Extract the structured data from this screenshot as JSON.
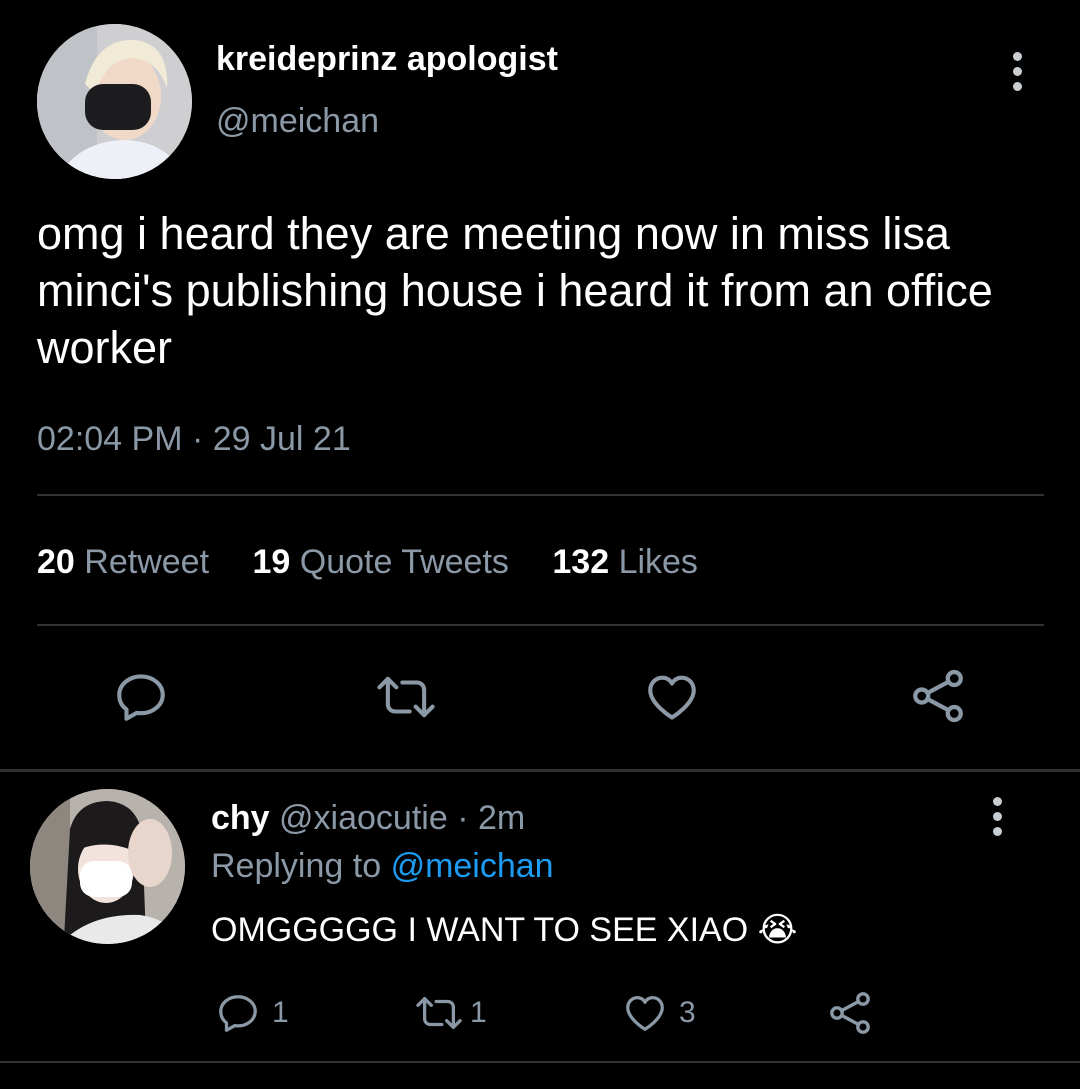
{
  "tweet": {
    "author_name": "kreideprinz apologist",
    "author_handle": "@meichan",
    "text": "omg i heard they are meeting now in miss lisa minci's publishing house i heard it from an office worker",
    "timestamp": "02:04 PM · 29 Jul 21",
    "stats": {
      "retweets": "20",
      "retweets_label": "Retweet",
      "quotes": "19",
      "quotes_label": "Quote Tweets",
      "likes": "132",
      "likes_label": "Likes"
    },
    "actions": [
      "reply-icon",
      "retweet-icon",
      "like-icon",
      "share-icon"
    ]
  },
  "reply": {
    "author_name": "chy",
    "author_handle": "@xiaocutie",
    "separator": "·",
    "time": "2m",
    "replying_prefix": "Replying to",
    "replying_handle": "@meichan",
    "text": "OMGGGGG I WANT TO SEE XIAO",
    "emoji": "😭",
    "counts": {
      "replies": "1",
      "retweets": "1",
      "likes": "3"
    }
  },
  "colors": {
    "background": "#000000",
    "text": "#ffffff",
    "secondary_text": "#8b98a5",
    "link": "#1d9bf0",
    "divider": "#2f3336",
    "icon": "#8b98a5"
  }
}
